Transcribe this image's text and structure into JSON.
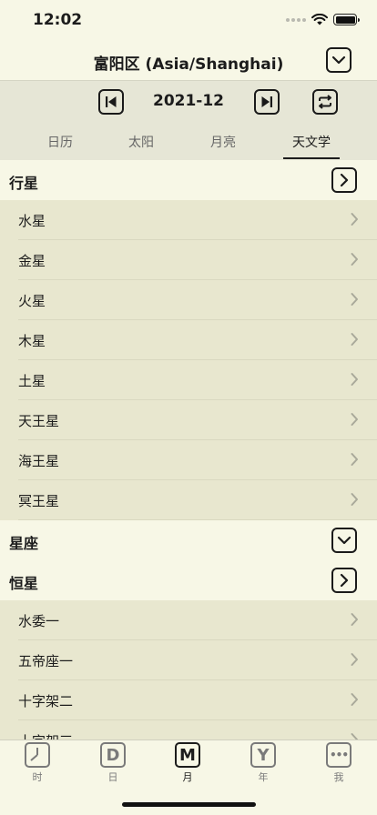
{
  "status": {
    "time": "12:02"
  },
  "nav": {
    "title": "富阳区 (Asia/Shanghai)"
  },
  "toolbar": {
    "date": "2021-12"
  },
  "tabs": [
    {
      "label": "日历",
      "active": false
    },
    {
      "label": "太阳",
      "active": false
    },
    {
      "label": "月亮",
      "active": false
    },
    {
      "label": "天文学",
      "active": true
    }
  ],
  "sections": {
    "planets": {
      "title": "行星",
      "expanded": true,
      "items": [
        "水星",
        "金星",
        "火星",
        "木星",
        "土星",
        "天王星",
        "海王星",
        "冥王星"
      ]
    },
    "constellations": {
      "title": "星座",
      "expanded": false
    },
    "stars": {
      "title": "恒星",
      "expanded": true,
      "items": [
        "水委一",
        "五帝座一",
        "十字架二",
        "十字架三"
      ]
    }
  },
  "tabbar": {
    "items": [
      {
        "label": "时",
        "icon": "clock-icon",
        "glyph": "",
        "selected": false
      },
      {
        "label": "日",
        "icon": "day-icon",
        "glyph": "D",
        "selected": false
      },
      {
        "label": "月",
        "icon": "month-icon",
        "glyph": "M",
        "selected": true
      },
      {
        "label": "年",
        "icon": "year-icon",
        "glyph": "Y",
        "selected": false
      },
      {
        "label": "我",
        "icon": "more-icon",
        "glyph": "•••",
        "selected": false
      }
    ]
  }
}
